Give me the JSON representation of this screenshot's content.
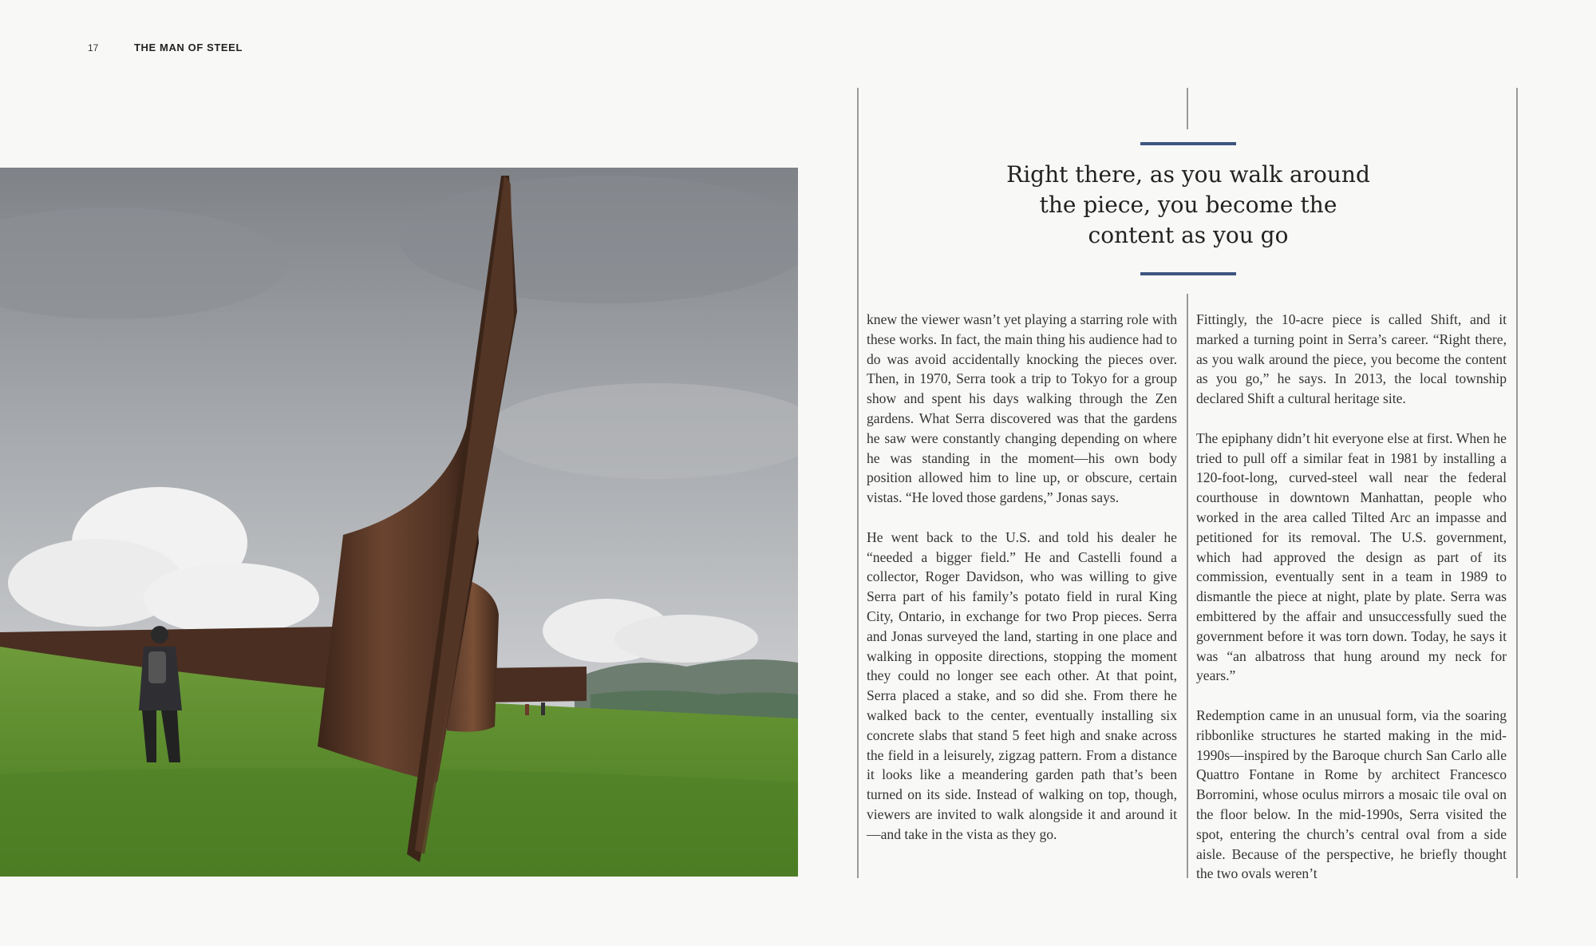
{
  "header": {
    "page_number": "17",
    "section_title": "THE MAN OF STEEL"
  },
  "pull_quote": "Right there, as you walk around the piece, you become the content as you go",
  "columns": {
    "left": [
      "knew the viewer wasn’t yet playing a starring role with these works. In fact, the main thing his audience had to do was avoid accidentally knocking the pieces over. Then, in 1970, Serra took a trip to Tokyo for a group show and spent his days walking through the Zen gardens. What Serra discovered was that the gardens he saw were constantly changing depending on where he was standing in the moment—his own body position allowed him to line up, or obscure, certain vistas. “He loved those gardens,” Jonas says.",
      "He went back to the U.S. and told his dealer he “needed a bigger field.” He and Castelli found a collector, Roger Davidson, who was willing to give Serra part of his family’s potato field in rural King City, Ontario, in exchange for two Prop pieces. Serra and Jonas surveyed the land, starting in one place and walking in opposite directions, stopping the moment they could no longer see each other. At that point, Serra placed a stake, and so did she. From there he walked back to the center, eventually installing six concrete slabs that stand 5 feet high and snake across the field in a leisurely, zigzag pattern. From a distance it looks like a meandering garden path that’s been turned on its side. Instead of walking on top, though, viewers are invited to walk alongside it and around it—and take in the vista as they go."
    ],
    "right": [
      "Fittingly, the 10-acre piece is called Shift, and it marked a turning point in Serra’s career. “Right there, as you walk around the piece, you become the content as you go,” he says. In 2013, the local township declared Shift a cultural heritage site.",
      "The epiphany didn’t hit everyone else at first. When he tried to pull off a similar feat in 1981 by installing a 120-foot-long, curved-steel wall near the federal courthouse in downtown Manhattan, people who worked in the area called Tilted Arc an impasse and petitioned for its removal. The U.S. government, which had approved the design as part of its commission, eventually sent in a team in 1989 to dismantle the piece at night, plate by plate. Serra was embittered by the affair and unsuccessfully sued the government before it was torn down. Today, he says it was “an albatross that hung around my neck for years.”",
      "Redemption came in an unusual form, via the soaring ribbonlike structures he started making in the mid-1990s—inspired by the Baroque church San Carlo alle Quattro Fontane in Rome by architect Francesco Borromini, whose oculus mirrors a mosaic tile oval on the floor below. In the mid-1990s, Serra visited the spot, entering the church’s central oval from a side aisle. Because of the perspective, he briefly thought the two ovals weren’t"
    ]
  },
  "colors": {
    "background": "#f8f8f6",
    "accent_rule": "#3d5680",
    "column_rule": "#9a9a9a",
    "text": "#333333"
  }
}
